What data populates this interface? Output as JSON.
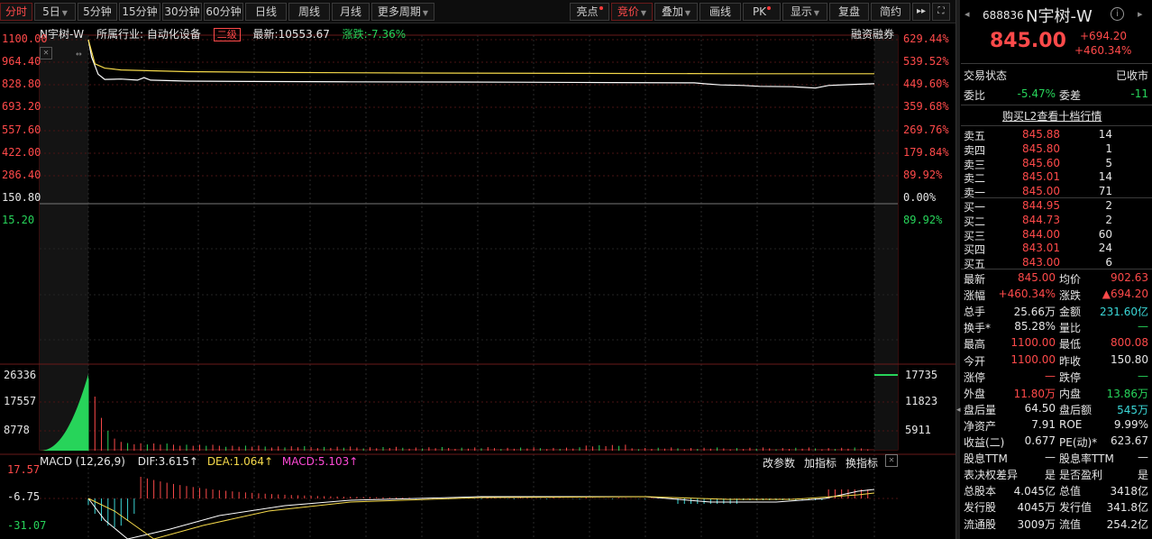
{
  "toolbar": {
    "left": [
      {
        "id": "fenshi",
        "label": "分时",
        "active": true
      },
      {
        "id": "5day",
        "label": "5日",
        "dropdown": true
      },
      {
        "id": "5min",
        "label": "5分钟"
      },
      {
        "id": "15min",
        "label": "15分钟"
      },
      {
        "id": "30min",
        "label": "30分钟"
      },
      {
        "id": "60min",
        "label": "60分钟"
      },
      {
        "id": "daily",
        "label": "日线"
      },
      {
        "id": "weekly",
        "label": "周线"
      },
      {
        "id": "monthly",
        "label": "月线"
      },
      {
        "id": "more",
        "label": "更多周期",
        "dropdown": true
      }
    ],
    "right": [
      {
        "id": "highlight",
        "label": "亮点",
        "dot": true
      },
      {
        "id": "bidding",
        "label": "竞价",
        "dropdown": true,
        "active": true
      },
      {
        "id": "overlay",
        "label": "叠加",
        "dropdown": true
      },
      {
        "id": "draw",
        "label": "画线"
      },
      {
        "id": "pk",
        "label": "PK",
        "dot": true
      },
      {
        "id": "display",
        "label": "显示",
        "dropdown": true
      },
      {
        "id": "review",
        "label": "复盘"
      },
      {
        "id": "simple",
        "label": "简约"
      }
    ]
  },
  "info": {
    "name": "N宇树-W",
    "industry": "所属行业: 自动化设备",
    "badge": "二级",
    "latest": "最新:10553.67",
    "change": "涨跌:-7.36%",
    "margin": "融资融券"
  },
  "price_axis": {
    "left": [
      "1100.00",
      "964.40",
      "828.80",
      "693.20",
      "557.60",
      "422.00",
      "286.40",
      "150.80",
      "15.20"
    ],
    "right": [
      "629.44%",
      "539.52%",
      "449.60%",
      "359.68%",
      "269.76%",
      "179.84%",
      "89.92%",
      "0.00%",
      "89.92%"
    ]
  },
  "volume_axis": {
    "left": [
      "26336",
      "17557",
      "8778"
    ],
    "right": [
      "17735",
      "11823",
      "5911"
    ]
  },
  "macd": {
    "title": "MACD (12,26,9)",
    "dif": "DIF:3.615↑",
    "dea": "DEA:1.064↑",
    "macd": "MACD:5.103↑",
    "axis": [
      "17.57",
      "-6.75",
      "-31.07"
    ],
    "links": [
      "改参数",
      "加指标",
      "换指标"
    ]
  },
  "quote": {
    "code": "688836",
    "name": "N宇树-W",
    "price": "845.00",
    "change": "+694.20",
    "change_pct": "+460.34%",
    "status_label": "交易状态",
    "status": "已收市",
    "weibi_label": "委比",
    "weibi": "-5.47%",
    "weicha_label": "委差",
    "weicha": "-11",
    "l2_link": "购买L2查看十档行情",
    "asks": [
      {
        "k": "卖五",
        "p": "845.88",
        "q": "14"
      },
      {
        "k": "卖四",
        "p": "845.80",
        "q": "1"
      },
      {
        "k": "卖三",
        "p": "845.60",
        "q": "5"
      },
      {
        "k": "卖二",
        "p": "845.01",
        "q": "14"
      },
      {
        "k": "卖一",
        "p": "845.00",
        "q": "71"
      }
    ],
    "bids": [
      {
        "k": "买一",
        "p": "844.95",
        "q": "2"
      },
      {
        "k": "买二",
        "p": "844.73",
        "q": "2"
      },
      {
        "k": "买三",
        "p": "844.00",
        "q": "60"
      },
      {
        "k": "买四",
        "p": "843.01",
        "q": "24"
      },
      {
        "k": "买五",
        "p": "843.00",
        "q": "6"
      }
    ],
    "stats": [
      {
        "l1": "最新",
        "v1": "845.00",
        "c1": "red",
        "l2": "均价",
        "v2": "902.63",
        "c2": "red"
      },
      {
        "l1": "涨幅",
        "v1": "+460.34%",
        "c1": "red",
        "l2": "涨跌",
        "v2": "▲694.20",
        "c2": "red"
      },
      {
        "l1": "总手",
        "v1": "25.66万",
        "c1": "wht",
        "l2": "金额",
        "v2": "231.60亿",
        "c2": "cyn"
      },
      {
        "l1": "换手*",
        "v1": "85.28%",
        "c1": "wht",
        "l2": "量比",
        "v2": "—",
        "c2": "grn"
      },
      {
        "l1": "最高",
        "v1": "1100.00",
        "c1": "red",
        "l2": "最低",
        "v2": "800.08",
        "c2": "red"
      },
      {
        "l1": "今开",
        "v1": "1100.00",
        "c1": "red",
        "l2": "昨收",
        "v2": "150.80",
        "c2": "wht"
      },
      {
        "l1": "涨停",
        "v1": "—",
        "c1": "red",
        "l2": "跌停",
        "v2": "—",
        "c2": "grn"
      },
      {
        "l1": "外盘",
        "v1": "11.80万",
        "c1": "red",
        "l2": "内盘",
        "v2": "13.86万",
        "c2": "grn"
      },
      {
        "l1": "盘后量",
        "v1": "64.50",
        "c1": "wht",
        "l2": "盘后额",
        "v2": "545万",
        "c2": "cyn"
      },
      {
        "l1": "净资产",
        "v1": "7.91",
        "c1": "wht",
        "l2": "ROE",
        "v2": "9.99%",
        "c2": "wht"
      },
      {
        "l1": "收益(二)",
        "v1": "0.677",
        "c1": "wht",
        "l2": "PE(动)*",
        "v2": "623.67",
        "c2": "wht"
      },
      {
        "l1": "股息TTM",
        "v1": "—",
        "c1": "wht",
        "l2": "股息率TTM",
        "v2": "—",
        "c2": "wht"
      },
      {
        "l1": "表决权差异",
        "v1": "是",
        "c1": "wht",
        "l2": "是否盈利",
        "v2": "是",
        "c2": "wht"
      },
      {
        "l1": "总股本",
        "v1": "4.045亿",
        "c1": "wht",
        "l2": "总值",
        "v2": "3418亿",
        "c2": "wht"
      },
      {
        "l1": "发行股",
        "v1": "4045万",
        "c1": "wht",
        "l2": "发行值",
        "v2": "341.8亿",
        "c2": "wht"
      },
      {
        "l1": "流通股",
        "v1": "3009万",
        "c1": "wht",
        "l2": "流值",
        "v2": "254.2亿",
        "c2": "wht"
      }
    ]
  },
  "colors": {
    "up": "#ff4a4a",
    "down": "#27d45a",
    "price_line": "#ffffff",
    "avg_line": "#f5d94a"
  }
}
